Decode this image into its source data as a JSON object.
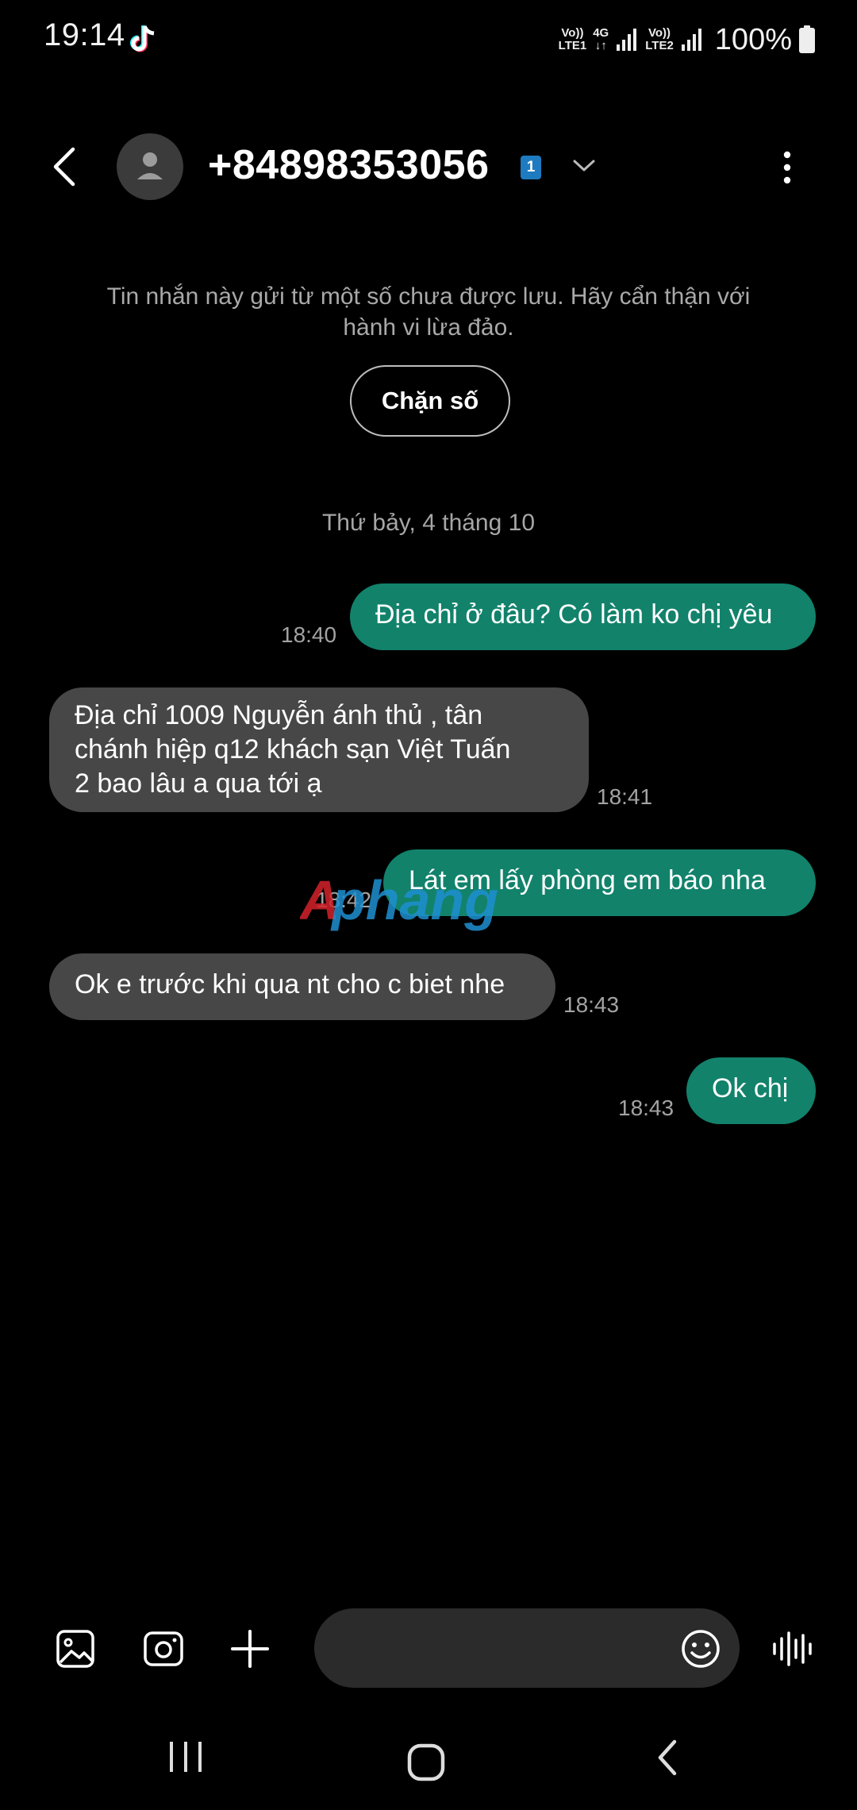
{
  "status_bar": {
    "time": "19:14",
    "net1_top": "Vo))",
    "net1_bottom": "LTE1",
    "net_4g_top": "4G",
    "net_4g_bottom": "↓↑",
    "net2_top": "Vo))",
    "net2_bottom": "LTE2",
    "battery": "100%"
  },
  "header": {
    "contact": "+84898353056",
    "sim_badge": "1"
  },
  "warning": {
    "text": "Tin nhắn này gửi từ một số chưa được lưu. Hãy cẩn thận với hành vi lừa đảo.",
    "block_label": "Chặn số"
  },
  "date_separator": "Thứ bảy, 4 tháng 10",
  "messages": [
    {
      "direction": "out",
      "lines": [
        "Địa chỉ ở đâu? Có làm ko chị yêu"
      ],
      "time": "18:40"
    },
    {
      "direction": "in",
      "lines": [
        "Địa chỉ 1009 Nguyễn ánh thủ , tân",
        "chánh hiệp q12 khách sạn Việt Tuấn",
        "2 bao lâu a qua tới ạ"
      ],
      "time": "18:41"
    },
    {
      "direction": "out",
      "lines": [
        "Lát em lấy phòng em báo nha"
      ],
      "time": "18:42"
    },
    {
      "direction": "in",
      "lines": [
        "Ok e trước khi qua nt cho c biet nhe"
      ],
      "time": "18:43"
    },
    {
      "direction": "out",
      "lines": [
        "Ok chị"
      ],
      "time": "18:43"
    }
  ],
  "watermark_text": "Aphang",
  "icons": {
    "status": [
      "tiktok-icon",
      "signal-icon",
      "battery-icon"
    ],
    "header": [
      "back-icon",
      "contact-avatar-icon",
      "chevron-down-icon",
      "more-options-icon"
    ],
    "composer": [
      "gallery-icon",
      "camera-icon",
      "plus-icon",
      "emoji-icon",
      "voice-icon"
    ],
    "nav": [
      "recent-apps-icon",
      "home-icon",
      "nav-back-icon"
    ]
  },
  "colors": {
    "background": "#000000",
    "outgoing_bubble": "#12826b",
    "incoming_bubble": "#474747",
    "sim_badge": "#1e7bc0",
    "muted_text": "#a6a6a6"
  }
}
